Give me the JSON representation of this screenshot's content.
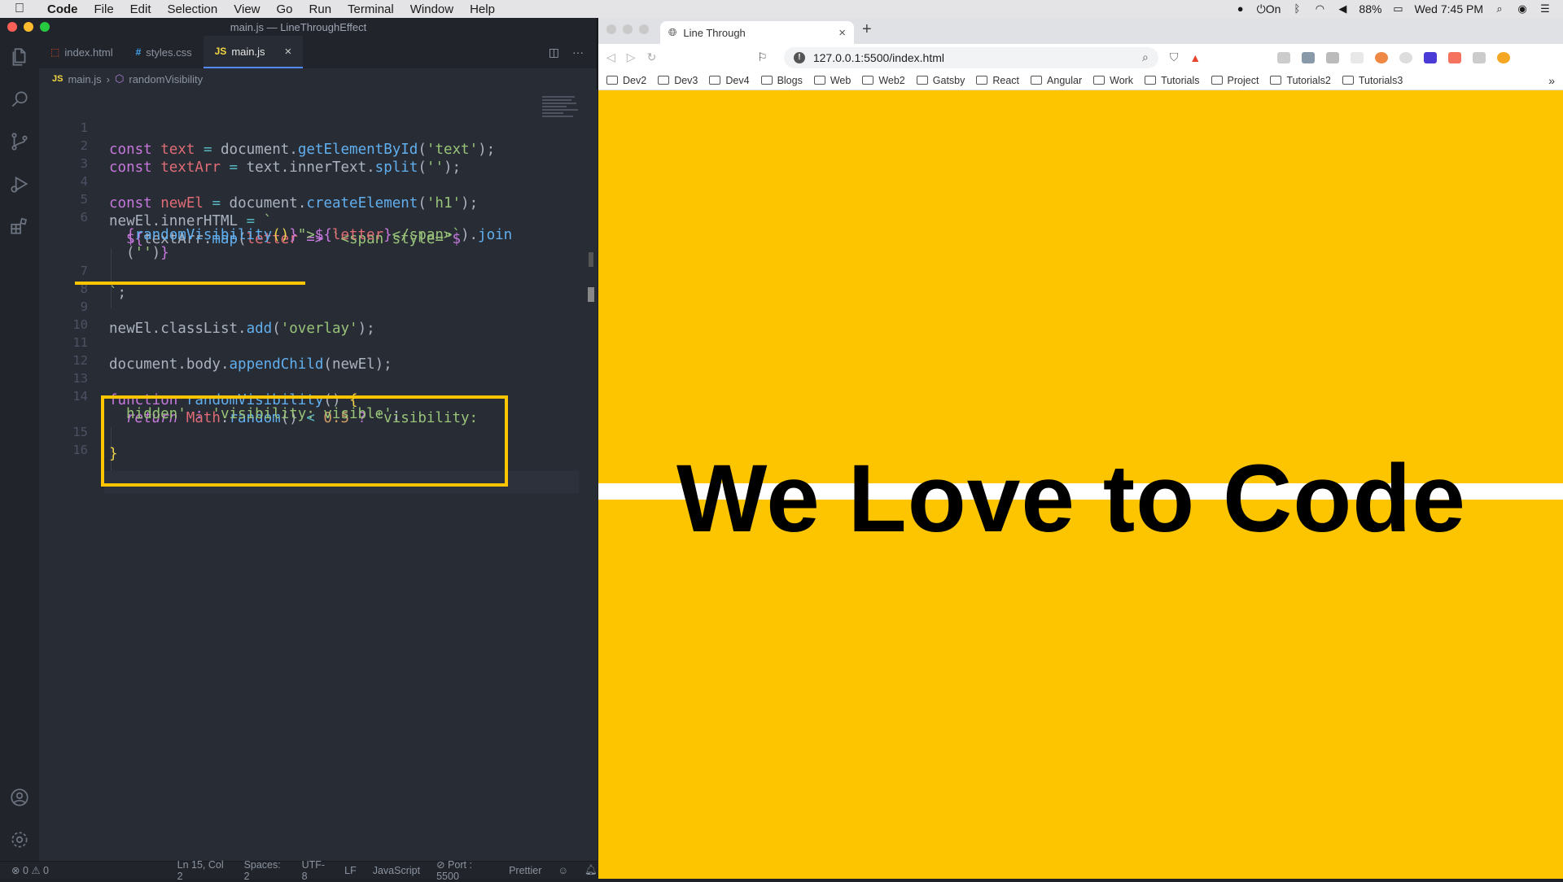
{
  "menubar": {
    "app": "Code",
    "items": [
      "File",
      "Edit",
      "Selection",
      "View",
      "Go",
      "Run",
      "Terminal",
      "Window",
      "Help"
    ],
    "status": {
      "focus_label": "On",
      "battery": "88%",
      "clock": "Wed 7:45 PM"
    }
  },
  "editor": {
    "window_title": "main.js — LineThroughEffect",
    "tabs": [
      {
        "label": "index.html",
        "icon": "html-file-icon",
        "active": false
      },
      {
        "label": "styles.css",
        "icon": "css-file-icon",
        "active": false
      },
      {
        "label": "main.js",
        "icon": "js-file-icon",
        "active": true
      }
    ],
    "breadcrumb": {
      "file": "main.js",
      "symbol": "randomVisibility"
    },
    "lines": [
      {
        "n": "1",
        "text": "const text = document.getElementById('text');"
      },
      {
        "n": "2",
        "text": "const textArr = text.innerText.split('');"
      },
      {
        "n": "3",
        "text": ""
      },
      {
        "n": "4",
        "text": "const newEl = document.createElement('h1');"
      },
      {
        "n": "5",
        "text": "newEl.innerHTML = `"
      },
      {
        "n": "6",
        "text": "${textArr.map(letter => `<span style=\"${randomVisibility()}\">${letter}</span>`).join('')}"
      },
      {
        "n": "7",
        "text": "`;"
      },
      {
        "n": "8",
        "text": ""
      },
      {
        "n": "9",
        "text": "newEl.classList.add('overlay');"
      },
      {
        "n": "10",
        "text": ""
      },
      {
        "n": "11",
        "text": "document.body.appendChild(newEl);"
      },
      {
        "n": "12",
        "text": ""
      },
      {
        "n": "13",
        "text": "function randomVisibility() {"
      },
      {
        "n": "14",
        "text": "return Math.random() < 0.5 ? 'visibility: hidden' : 'visibility: visible';"
      },
      {
        "n": "15",
        "text": "}"
      },
      {
        "n": "16",
        "text": ""
      }
    ],
    "status": {
      "problems": "⊗ 0 ⚠ 0",
      "position": "Ln 15, Col 2",
      "spaces": "Spaces: 2",
      "encoding": "UTF-8",
      "eol": "LF",
      "language": "JavaScript",
      "port": "⊘ Port : 5500",
      "formatter": "Prettier"
    }
  },
  "browser": {
    "tab_title": "Line Through",
    "url": "127.0.0.1:5500/index.html",
    "bookmarks": [
      "Dev2",
      "Dev3",
      "Dev4",
      "Blogs",
      "Web",
      "Web2",
      "Gatsby",
      "React",
      "Angular",
      "Work",
      "Tutorials",
      "Project",
      "Tutorials2",
      "Tutorials3"
    ],
    "page": {
      "headline": "We Love to Code",
      "background": "#fdc500",
      "strike_color": "#ffffff"
    }
  },
  "accent": "#ffc600"
}
